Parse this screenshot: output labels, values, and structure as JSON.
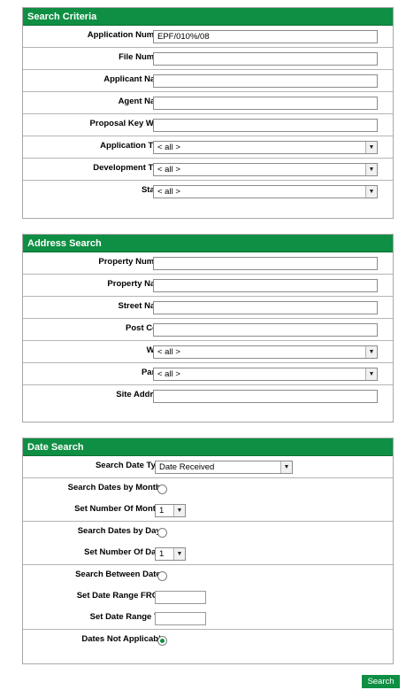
{
  "search_criteria": {
    "title": "Search Criteria",
    "fields": [
      {
        "label": "Application Number",
        "value": "EPF/010%/08"
      },
      {
        "label": "File Number",
        "value": ""
      },
      {
        "label": "Applicant Name",
        "value": ""
      },
      {
        "label": "Agent Name",
        "value": ""
      },
      {
        "label": "Proposal Key Word",
        "value": ""
      },
      {
        "label": "Application Type",
        "value": "< all >"
      },
      {
        "label": "Development Type",
        "value": "< all >"
      },
      {
        "label": "Status",
        "value": "< all >"
      }
    ]
  },
  "address_search": {
    "title": "Address Search",
    "fields": [
      {
        "label": "Property Number",
        "value": ""
      },
      {
        "label": "Property Name",
        "value": ""
      },
      {
        "label": "Street Name",
        "value": ""
      },
      {
        "label": "Post Code",
        "value": ""
      },
      {
        "label": "Ward",
        "value": "< all >"
      },
      {
        "label": "Parish",
        "value": "< all >"
      },
      {
        "label": "Site Address",
        "value": ""
      }
    ]
  },
  "date_search": {
    "title": "Date Search",
    "search_date_type_label": "Search Date Type",
    "search_date_type_value": "Date Received",
    "by_months_label": "Search Dates by Months",
    "by_months_selected": false,
    "num_months_label": "Set Number Of Months",
    "num_months_value": "1",
    "by_days_label": "Search Dates by Days",
    "by_days_selected": false,
    "num_days_label": "Set Number Of Days",
    "num_days_value": "1",
    "between_label": "Search Between Dates",
    "between_selected": false,
    "from_label": "Set Date Range FROM",
    "from_value": "",
    "to_label": "Set Date Range TO",
    "to_value": "",
    "not_applicable_label": "Dates Not Applicable",
    "not_applicable_selected": true
  },
  "search_button_label": "Search",
  "arrow_glyph": "▼"
}
